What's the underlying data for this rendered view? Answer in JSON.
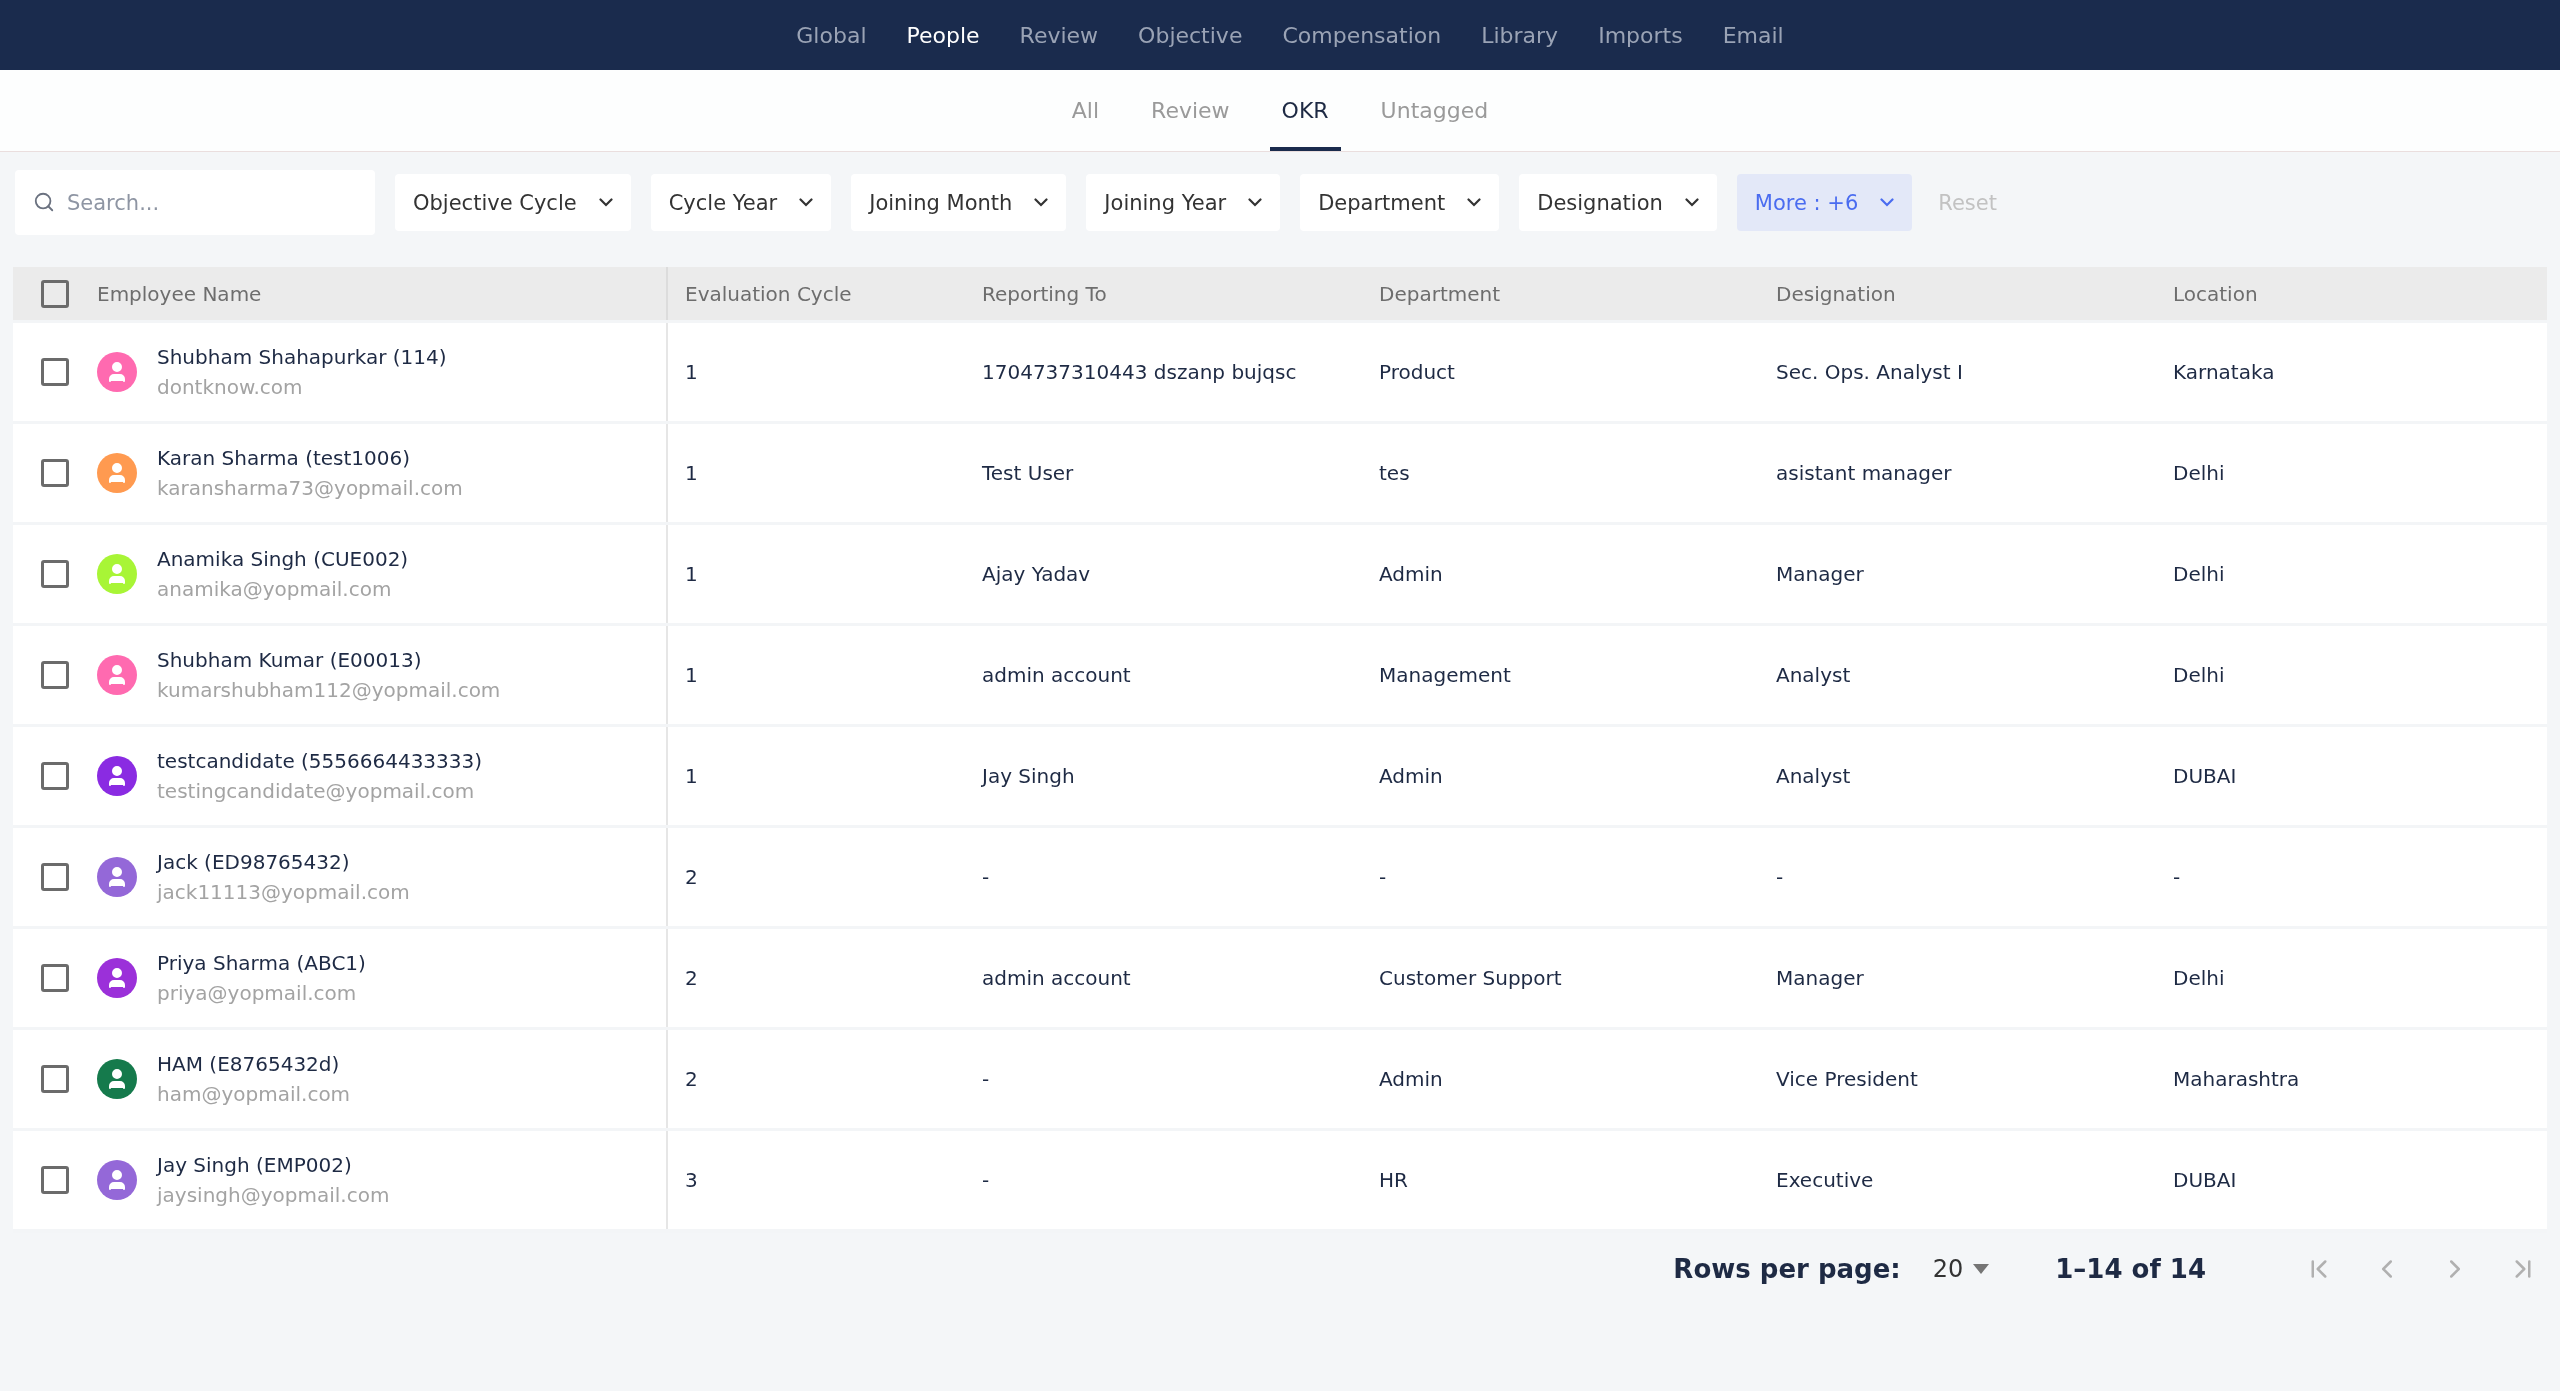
{
  "top_nav": [
    {
      "label": "Global",
      "selected": false
    },
    {
      "label": "People",
      "selected": true
    },
    {
      "label": "Review",
      "selected": false
    },
    {
      "label": "Objective",
      "selected": false
    },
    {
      "label": "Compensation",
      "selected": false
    },
    {
      "label": "Library",
      "selected": false
    },
    {
      "label": "Imports",
      "selected": false
    },
    {
      "label": "Email",
      "selected": false
    }
  ],
  "sub_tabs": [
    {
      "label": "All",
      "selected": false
    },
    {
      "label": "Review",
      "selected": false
    },
    {
      "label": "OKR",
      "selected": true
    },
    {
      "label": "Untagged",
      "selected": false
    }
  ],
  "search": {
    "placeholder": "Search..."
  },
  "filters": [
    {
      "label": "Objective Cycle",
      "kind": "plain"
    },
    {
      "label": "Cycle Year",
      "kind": "plain"
    },
    {
      "label": "Joining Month",
      "kind": "plain"
    },
    {
      "label": "Joining Year",
      "kind": "plain"
    },
    {
      "label": "Department",
      "kind": "plain"
    },
    {
      "label": "Designation",
      "kind": "plain"
    },
    {
      "label": "More : +6",
      "kind": "more"
    }
  ],
  "reset": {
    "label": "Reset",
    "disabled": true
  },
  "table": {
    "select_all_checked": false,
    "columns": [
      "Employee Name",
      "Evaluation Cycle",
      "Reporting To",
      "Department",
      "Designation",
      "Location"
    ],
    "rows": [
      {
        "checked": false,
        "color": "#ff6ab0",
        "name": "Shubham Shahapurkar (114)",
        "email": "dontknow.com",
        "cycle": "1",
        "reporting_to": "1704737310443 dszanp bujqsc",
        "department": "Product",
        "designation": "Sec. Ops. Analyst I",
        "location": "Karnataka"
      },
      {
        "checked": false,
        "color": "#ff9a50",
        "name": "Karan Sharma (test1006)",
        "email": "karansharma73@yopmail.com",
        "cycle": "1",
        "reporting_to": "Test User",
        "department": "tes",
        "designation": "asistant manager",
        "location": "Delhi"
      },
      {
        "checked": false,
        "color": "#a8f536",
        "name": "Anamika Singh (CUE002)",
        "email": "anamika@yopmail.com",
        "cycle": "1",
        "reporting_to": "Ajay Yadav",
        "department": "Admin",
        "designation": "Manager",
        "location": "Delhi"
      },
      {
        "checked": false,
        "color": "#ff6ab0",
        "name": "Shubham Kumar (E00013)",
        "email": "kumarshubham112@yopmail.com",
        "cycle": "1",
        "reporting_to": "admin account",
        "department": "Management",
        "designation": "Analyst",
        "location": "Delhi"
      },
      {
        "checked": false,
        "color": "#8a2be2",
        "name": "testcandidate (5556664433333)",
        "email": "testingcandidate@yopmail.com",
        "cycle": "1",
        "reporting_to": "Jay Singh",
        "department": "Admin",
        "designation": "Analyst",
        "location": "DUBAI"
      },
      {
        "checked": false,
        "color": "#9468d8",
        "name": "Jack (ED98765432)",
        "email": "jack11113@yopmail.com",
        "cycle": "2",
        "reporting_to": "-",
        "department": "-",
        "designation": "-",
        "location": "-"
      },
      {
        "checked": false,
        "color": "#9b30d9",
        "name": "Priya Sharma (ABC1)",
        "email": "priya@yopmail.com",
        "cycle": "2",
        "reporting_to": "admin account",
        "department": "Customer Support",
        "designation": "Manager",
        "location": "Delhi"
      },
      {
        "checked": false,
        "color": "#157a4c",
        "name": "HAM (E8765432d)",
        "email": "ham@yopmail.com",
        "cycle": "2",
        "reporting_to": "-",
        "department": "Admin",
        "designation": "Vice President",
        "location": "Maharashtra"
      },
      {
        "checked": false,
        "color": "#9468d8",
        "name": "Jay Singh (EMP002)",
        "email": "jaysingh@yopmail.com",
        "cycle": "3",
        "reporting_to": "-",
        "department": "HR",
        "designation": "Executive",
        "location": "DUBAI"
      }
    ]
  },
  "pagination": {
    "rows_per_page_label": "Rows per page:",
    "rows_per_page": "20",
    "range": "1–14 of 14"
  }
}
